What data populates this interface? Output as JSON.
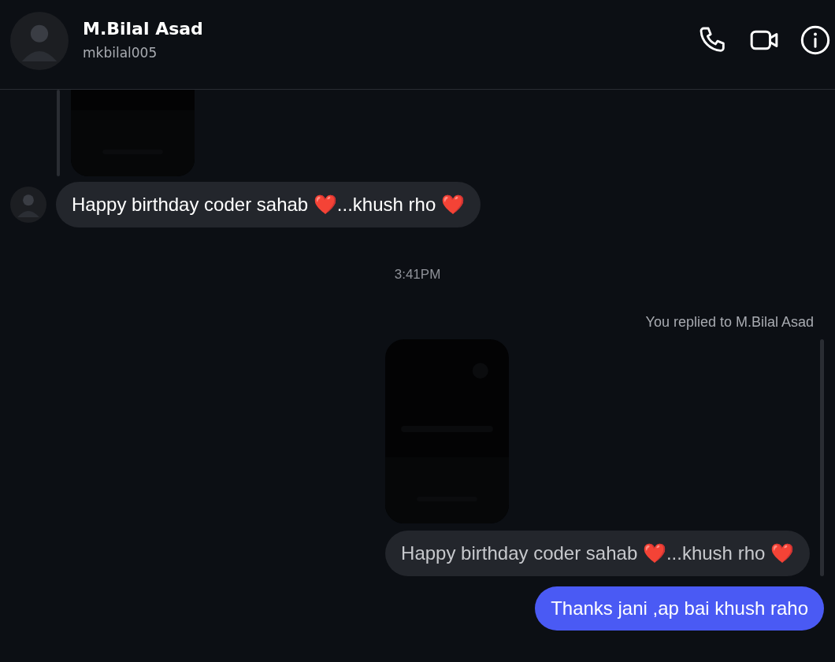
{
  "header": {
    "name": "M.Bilal Asad",
    "username": "mkbilal005"
  },
  "messages": [
    {
      "kind": "story",
      "outgoing": false
    },
    {
      "kind": "text",
      "outgoing": false,
      "text": "Happy birthday coder sahab ❤️...khush rho ❤️"
    },
    {
      "kind": "time",
      "text": "3:41PM"
    },
    {
      "kind": "reply_label",
      "outgoing": true,
      "text": "You replied to M.Bilal Asad"
    },
    {
      "kind": "quoted_story",
      "outgoing": true,
      "quote": "Happy birthday coder sahab ❤️...khush rho ❤️"
    },
    {
      "kind": "text",
      "outgoing": true,
      "text": "Thanks jani ,ap bai khush raho"
    }
  ]
}
